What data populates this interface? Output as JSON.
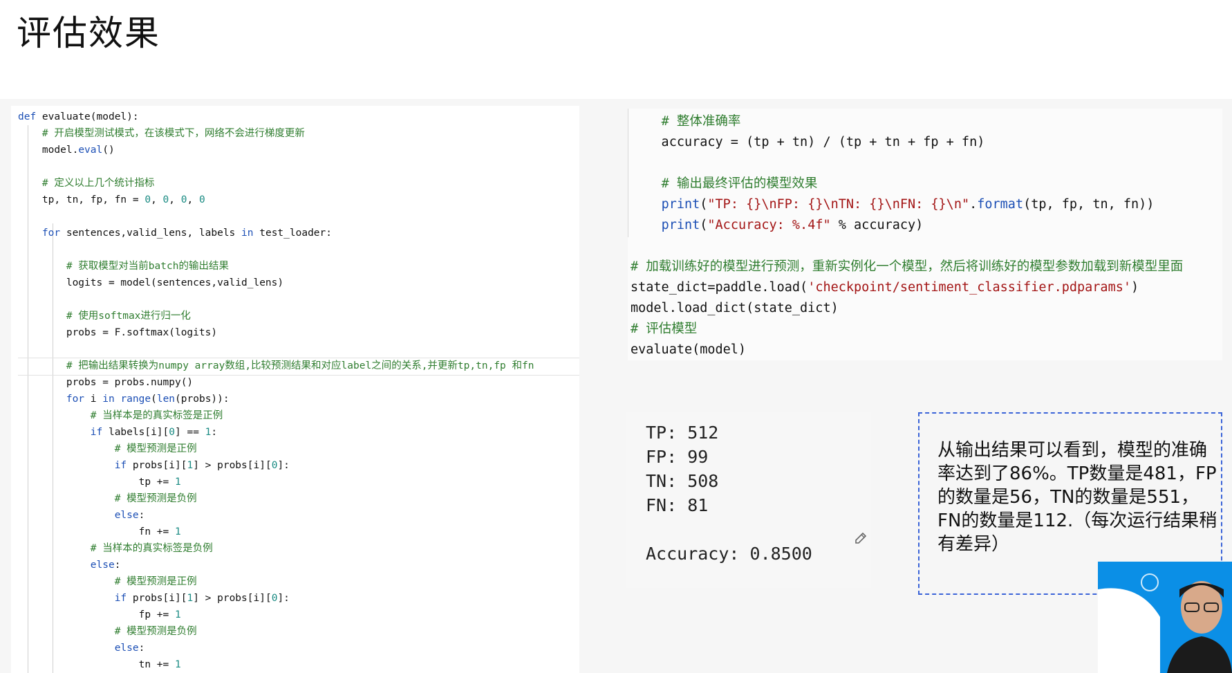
{
  "slide": {
    "title": "评估效果"
  },
  "code_left": {
    "lines": [
      [
        {
          "t": "def",
          "c": "kw"
        },
        {
          "t": " evaluate(model):"
        }
      ],
      [
        {
          "t": "    "
        },
        {
          "t": "# 开启模型测试模式，在该模式下，网络不会进行梯度更新",
          "c": "cm"
        }
      ],
      [
        {
          "t": "    model."
        },
        {
          "t": "eval",
          "c": "fn"
        },
        {
          "t": "()"
        }
      ],
      [
        {
          "t": ""
        }
      ],
      [
        {
          "t": "    "
        },
        {
          "t": "# 定义以上几个统计指标",
          "c": "cm"
        }
      ],
      [
        {
          "t": "    tp, tn, fp, fn = "
        },
        {
          "t": "0",
          "c": "num"
        },
        {
          "t": ", "
        },
        {
          "t": "0",
          "c": "num"
        },
        {
          "t": ", "
        },
        {
          "t": "0",
          "c": "num"
        },
        {
          "t": ", "
        },
        {
          "t": "0",
          "c": "num"
        }
      ],
      [
        {
          "t": ""
        }
      ],
      [
        {
          "t": "    "
        },
        {
          "t": "for",
          "c": "kw"
        },
        {
          "t": " sentences,valid_lens, labels "
        },
        {
          "t": "in",
          "c": "kw"
        },
        {
          "t": " test_loader:"
        }
      ],
      [
        {
          "t": ""
        }
      ],
      [
        {
          "t": "        "
        },
        {
          "t": "# 获取模型对当前batch的输出结果",
          "c": "cm"
        }
      ],
      [
        {
          "t": "        logits = model(sentences,valid_lens)"
        }
      ],
      [
        {
          "t": ""
        }
      ],
      [
        {
          "t": "        "
        },
        {
          "t": "# 使用softmax进行归一化",
          "c": "cm"
        }
      ],
      [
        {
          "t": "        probs = F.softmax(logits)"
        }
      ],
      [
        {
          "t": ""
        }
      ],
      [
        {
          "t": "        "
        },
        {
          "t": "# 把输出结果转换为numpy array数组,比较预测结果和对应label之间的关系,并更新tp,tn,fp 和fn",
          "c": "cm"
        }
      ],
      [
        {
          "t": "        probs = probs.numpy()"
        }
      ],
      [
        {
          "t": "        "
        },
        {
          "t": "for",
          "c": "kw"
        },
        {
          "t": " i "
        },
        {
          "t": "in",
          "c": "kw"
        },
        {
          "t": " "
        },
        {
          "t": "range",
          "c": "fn"
        },
        {
          "t": "("
        },
        {
          "t": "len",
          "c": "fn"
        },
        {
          "t": "(probs)):"
        }
      ],
      [
        {
          "t": "            "
        },
        {
          "t": "# 当样本是的真实标签是正例",
          "c": "cm"
        }
      ],
      [
        {
          "t": "            "
        },
        {
          "t": "if",
          "c": "kw"
        },
        {
          "t": " labels[i]["
        },
        {
          "t": "0",
          "c": "num"
        },
        {
          "t": "] == "
        },
        {
          "t": "1",
          "c": "num"
        },
        {
          "t": ":"
        }
      ],
      [
        {
          "t": "                "
        },
        {
          "t": "# 模型预测是正例",
          "c": "cm"
        }
      ],
      [
        {
          "t": "                "
        },
        {
          "t": "if",
          "c": "kw"
        },
        {
          "t": " probs[i]["
        },
        {
          "t": "1",
          "c": "num"
        },
        {
          "t": "] > probs[i]["
        },
        {
          "t": "0",
          "c": "num"
        },
        {
          "t": "]:"
        }
      ],
      [
        {
          "t": "                    tp += "
        },
        {
          "t": "1",
          "c": "num"
        }
      ],
      [
        {
          "t": "                "
        },
        {
          "t": "# 模型预测是负例",
          "c": "cm"
        }
      ],
      [
        {
          "t": "                "
        },
        {
          "t": "else",
          "c": "kw"
        },
        {
          "t": ":"
        }
      ],
      [
        {
          "t": "                    fn += "
        },
        {
          "t": "1",
          "c": "num"
        }
      ],
      [
        {
          "t": "            "
        },
        {
          "t": "# 当样本的真实标签是负例",
          "c": "cm"
        }
      ],
      [
        {
          "t": "            "
        },
        {
          "t": "else",
          "c": "kw"
        },
        {
          "t": ":"
        }
      ],
      [
        {
          "t": "                "
        },
        {
          "t": "# 模型预测是正例",
          "c": "cm"
        }
      ],
      [
        {
          "t": "                "
        },
        {
          "t": "if",
          "c": "kw"
        },
        {
          "t": " probs[i]["
        },
        {
          "t": "1",
          "c": "num"
        },
        {
          "t": "] > probs[i]["
        },
        {
          "t": "0",
          "c": "num"
        },
        {
          "t": "]:"
        }
      ],
      [
        {
          "t": "                    fp += "
        },
        {
          "t": "1",
          "c": "num"
        }
      ],
      [
        {
          "t": "                "
        },
        {
          "t": "# 模型预测是负例",
          "c": "cm"
        }
      ],
      [
        {
          "t": "                "
        },
        {
          "t": "else",
          "c": "kw"
        },
        {
          "t": ":"
        }
      ],
      [
        {
          "t": "                    tn += "
        },
        {
          "t": "1",
          "c": "num"
        }
      ]
    ]
  },
  "code_right": {
    "lines": [
      [
        {
          "t": "    "
        },
        {
          "t": "# 整体准确率",
          "c": "cm"
        }
      ],
      [
        {
          "t": "    accuracy = (tp + tn) / (tp + tn + fp + fn)"
        }
      ],
      [
        {
          "t": ""
        }
      ],
      [
        {
          "t": "    "
        },
        {
          "t": "# 输出最终评估的模型效果",
          "c": "cm"
        }
      ],
      [
        {
          "t": "    "
        },
        {
          "t": "print",
          "c": "fn"
        },
        {
          "t": "("
        },
        {
          "t": "\"TP: {}\\nFP: {}\\nTN: {}\\nFN: {}\\n\"",
          "c": "str"
        },
        {
          "t": "."
        },
        {
          "t": "format",
          "c": "fn"
        },
        {
          "t": "(tp, fp, tn, fn))"
        }
      ],
      [
        {
          "t": "    "
        },
        {
          "t": "print",
          "c": "fn"
        },
        {
          "t": "("
        },
        {
          "t": "\"Accuracy: %.4f\"",
          "c": "str"
        },
        {
          "t": " % accuracy)"
        }
      ],
      [
        {
          "t": ""
        }
      ],
      [
        {
          "t": "# 加载训练好的模型进行预测，重新实例化一个模型，然后将训练好的模型参数加载到新模型里面",
          "c": "cm"
        }
      ],
      [
        {
          "t": "state_dict=paddle.load("
        },
        {
          "t": "'checkpoint/sentiment_classifier.pdparams'",
          "c": "str"
        },
        {
          "t": ")"
        }
      ],
      [
        {
          "t": "model.load_dict(state_dict)"
        }
      ],
      [
        {
          "t": "# 评估模型",
          "c": "cm"
        }
      ],
      [
        {
          "t": "evaluate(model)"
        }
      ]
    ]
  },
  "output": {
    "lines": [
      "TP: 512",
      "FP: 99",
      "TN: 508",
      "FN: 81",
      "",
      "Accuracy: 0.8500"
    ]
  },
  "note": {
    "text": "从输出结果可以看到，模型的准确率达到了86%。TP数量是481，FP的数量是56，TN的数量是551，FN的数量是112.（每次运行结果稍有差异）"
  },
  "icons": [
    "pencil-icon",
    "presenter-webcam"
  ],
  "colors": {
    "keyword": "#1c4fb5",
    "comment": "#2f7d2f",
    "string": "#a31515",
    "number": "#1a8b83",
    "note_border": "#3a63d8",
    "webcam_bg": "#0b8fe6"
  }
}
